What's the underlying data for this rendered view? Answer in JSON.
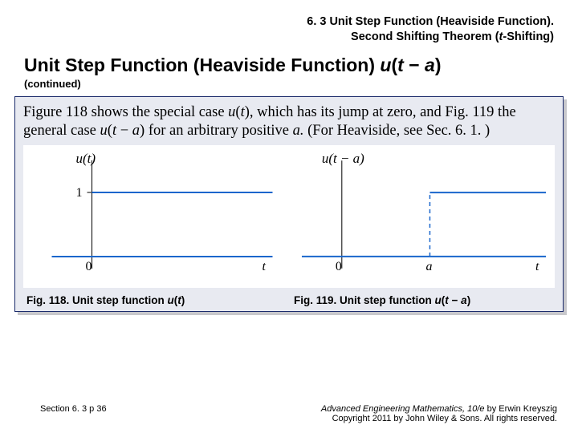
{
  "header": {
    "line1": "6. 3 Unit Step Function (Heaviside Function).",
    "line2_a": "Second Shifting Theorem (",
    "line2_t": "t",
    "line2_b": "-Shifting)"
  },
  "title": {
    "main": "Unit Step Function (Heaviside Function) ",
    "fn_u": "u",
    "fn_open": "(",
    "fn_t": "t",
    "fn_minus": " − ",
    "fn_a": "a",
    "fn_close": ")"
  },
  "subtitle": "(continued)",
  "body": {
    "p1a": "Figure 118 shows the special case ",
    "p1u": "u",
    "p1op": "(",
    "p1t": "t",
    "p1cl": ")",
    "p1b": ", which has its jump at zero, and Fig. 119 the general case ",
    "p2u": "u",
    "p2op": "(",
    "p2t": "t",
    "p2m": " − ",
    "p2a": "a",
    "p2cl": ")",
    "p1c": " for an arbitrary positive ",
    "p3a": "a.",
    "p1d": " (For Heaviside, see Sec. 6. 1. )"
  },
  "fig118": {
    "label_fn": "u(t)",
    "tick1": "1",
    "origin": "0",
    "axis_t": "t"
  },
  "fig119": {
    "label_fn": "u(t − a)",
    "origin": "0",
    "jump": "a",
    "axis_t": "t"
  },
  "captions": {
    "c1_a": "Fig. 118.",
    "c1_b": " Unit step function ",
    "c1_u": "u",
    "c1_op": "(",
    "c1_t": "t",
    "c1_cl": ")",
    "c2_a": "Fig. 119.",
    "c2_b": " Unit step function ",
    "c2_u": "u",
    "c2_op": "(",
    "c2_t": "t",
    "c2_m": " − ",
    "c2_ai": "a",
    "c2_cl": ")"
  },
  "footer": {
    "left": "Section 6. 3  p 36",
    "right1a": "Advanced Engineering Mathematics, 10/e",
    "right1b": " by Erwin Kreyszig",
    "right2": "Copyright 2011 by John Wiley & Sons. All rights reserved."
  },
  "chart_data": [
    {
      "type": "line",
      "title": "u(t)",
      "xlabel": "t",
      "ylabel": "",
      "xlim": [
        -0.6,
        3.5
      ],
      "ylim": [
        -0.2,
        1.4
      ],
      "yticks": [
        1
      ],
      "series": [
        {
          "name": "u(t)",
          "x": [
            -0.6,
            0,
            0,
            3.5
          ],
          "y": [
            0,
            0,
            1,
            1
          ]
        }
      ],
      "jump_x": 0
    },
    {
      "type": "line",
      "title": "u(t − a)",
      "xlabel": "t",
      "ylabel": "",
      "xlim": [
        -0.6,
        3.5
      ],
      "ylim": [
        -0.2,
        1.4
      ],
      "xticks_labels": [
        "0",
        "a"
      ],
      "series": [
        {
          "name": "u(t − a)",
          "x": [
            -0.6,
            1.6,
            1.6,
            3.5
          ],
          "y": [
            0,
            0,
            1,
            1
          ]
        }
      ],
      "jump_x": 1.6
    }
  ]
}
